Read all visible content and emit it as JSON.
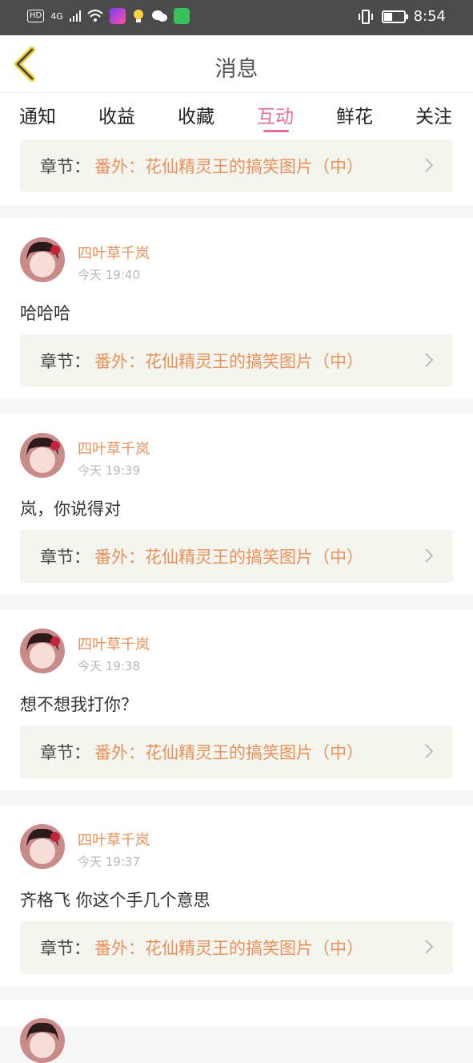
{
  "status_bar": {
    "left_badges": [
      "HD",
      "4G"
    ],
    "time": "8:54",
    "battery_level": 0.45
  },
  "header": {
    "title": "消息"
  },
  "tabs": [
    {
      "label": "通知",
      "active": false
    },
    {
      "label": "收益",
      "active": false
    },
    {
      "label": "收藏",
      "active": false
    },
    {
      "label": "互动",
      "active": true
    },
    {
      "label": "鲜花",
      "active": false
    },
    {
      "label": "关注",
      "active": false
    }
  ],
  "top_chapter": {
    "label": "章节：",
    "title": "番外：花仙精灵王的搞笑图片（中）"
  },
  "messages": [
    {
      "user": "四叶草千岚",
      "time": "今天 19:40",
      "text": "哈哈哈",
      "chapter_label": "章节：",
      "chapter_title": "番外：花仙精灵王的搞笑图片（中）"
    },
    {
      "user": "四叶草千岚",
      "time": "今天 19:39",
      "text": "岚，你说得对",
      "chapter_label": "章节：",
      "chapter_title": "番外：花仙精灵王的搞笑图片（中）"
    },
    {
      "user": "四叶草千岚",
      "time": "今天 19:38",
      "text": "想不想我打你？",
      "chapter_label": "章节：",
      "chapter_title": "番外：花仙精灵王的搞笑图片（中）"
    },
    {
      "user": "四叶草千岚",
      "time": "今天 19:37",
      "text": "齐格飞 你这个手几个意思",
      "chapter_label": "章节：",
      "chapter_title": "番外：花仙精灵王的搞笑图片（中）"
    }
  ],
  "colors": {
    "accent": "#e56c9c",
    "username": "#e9915a",
    "chapter_bg": "#f5f5ef"
  }
}
